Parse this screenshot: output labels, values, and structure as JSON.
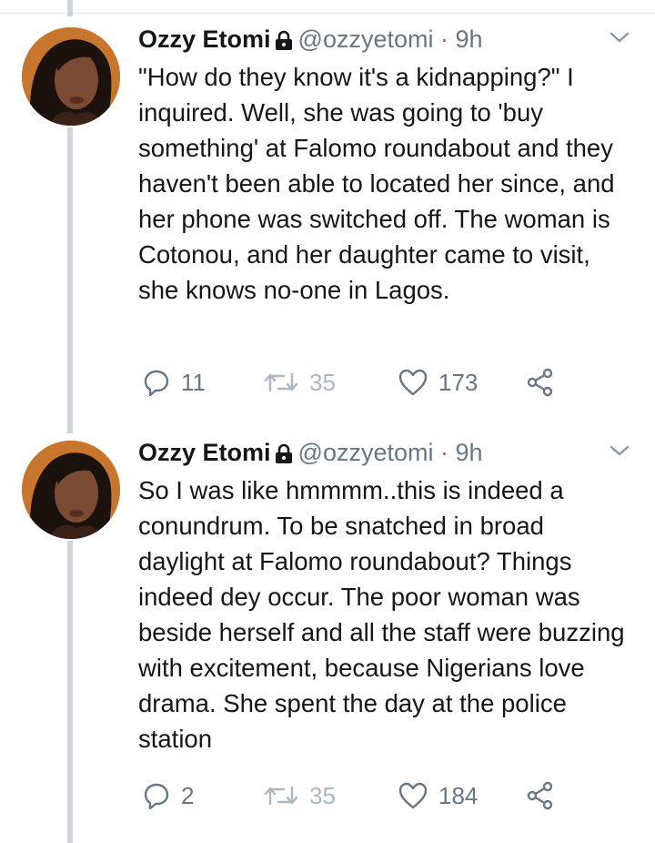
{
  "tweets": [
    {
      "name": "Ozzy Etomi",
      "handle": "@ozzyetomi",
      "separator": "·",
      "time": "9h",
      "text": "\"How do they know it's a kidnapping?\" I inquired. Well, she was going to 'buy something' at Falomo roundabout and they haven't been able to located her since, and her phone was switched off. The woman is Cotonou, and her daughter came to visit, she knows no-one in Lagos.",
      "replies": "11",
      "retweets": "35",
      "likes": "173"
    },
    {
      "name": "Ozzy Etomi",
      "handle": "@ozzyetomi",
      "separator": "·",
      "time": "9h",
      "text": "So I was like hmmmm..this is indeed a conundrum. To be snatched in broad daylight at Falomo roundabout? Things indeed dey occur. The poor woman was beside herself and all the staff were buzzing with excitement, because Nigerians love drama. She spent the day at the police station",
      "replies": "2",
      "retweets": "35",
      "likes": "184"
    }
  ],
  "colors": {
    "text": "#14171a",
    "secondary": "#657786",
    "thread_line": "#ccd6dd",
    "retweet_icon": "#aab8c2"
  },
  "icons": [
    "lock-icon",
    "chevron-down-icon",
    "reply-icon",
    "retweet-icon",
    "heart-icon",
    "share-icon"
  ]
}
